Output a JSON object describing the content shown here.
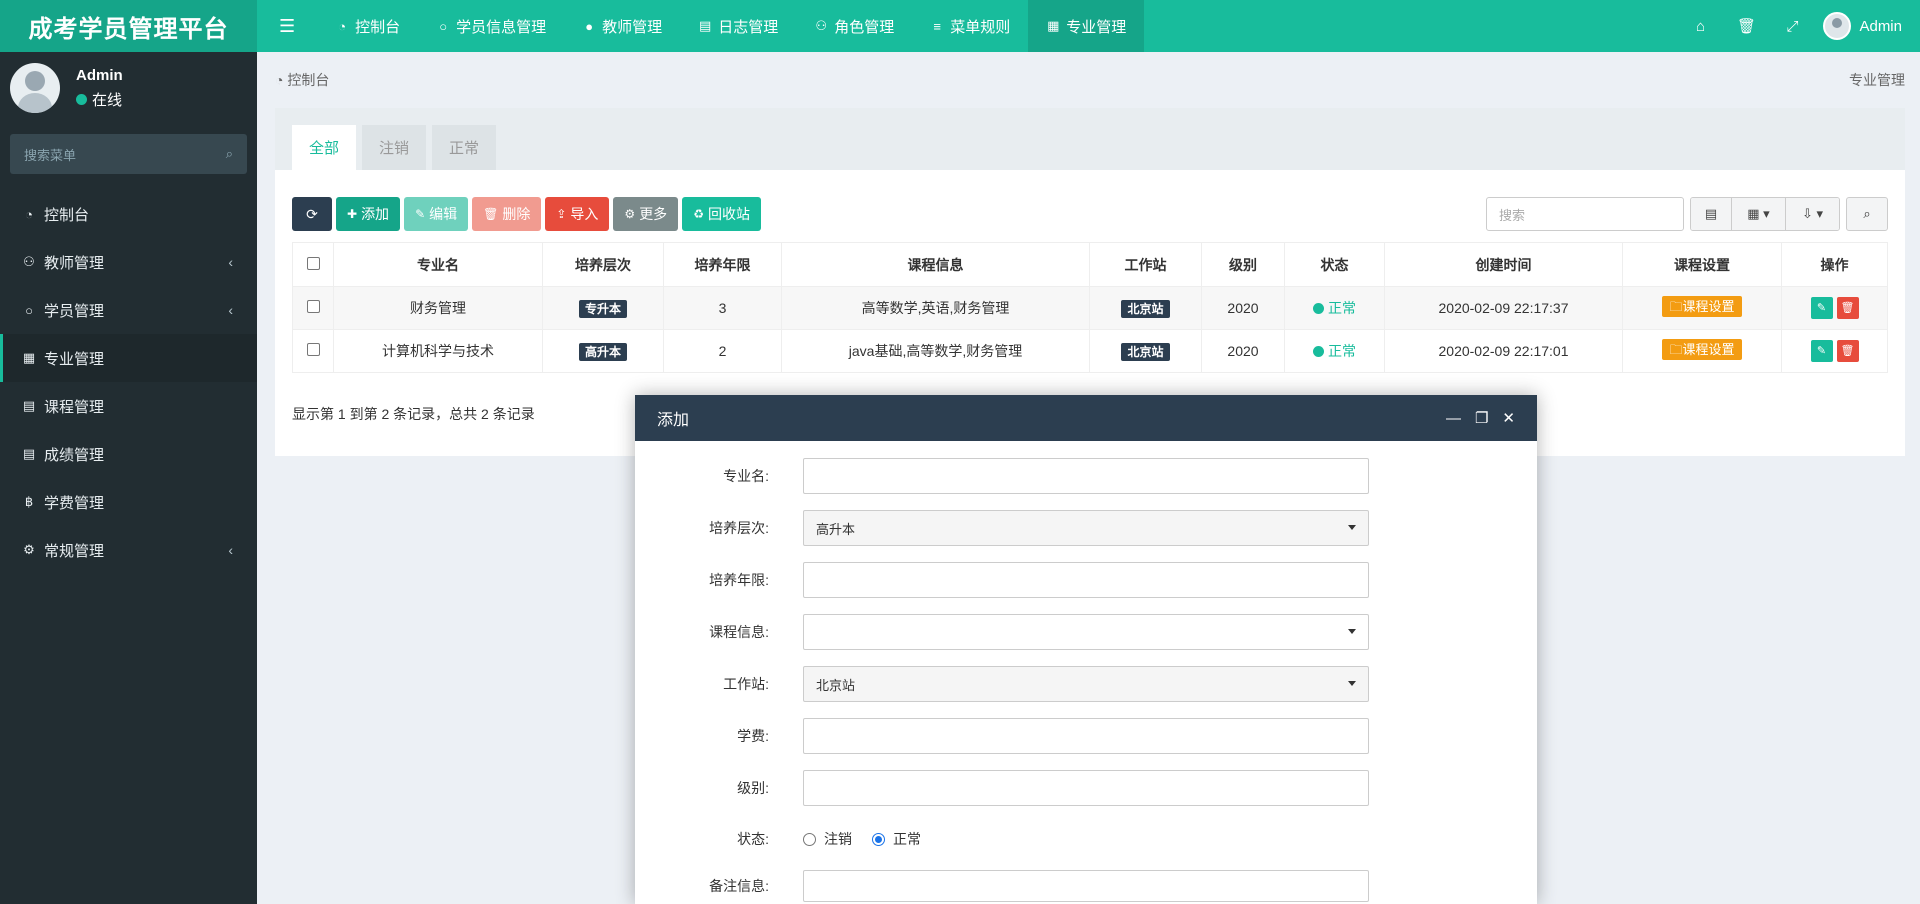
{
  "app": {
    "title": "成考学员管理平台"
  },
  "topnav": {
    "items": [
      {
        "label": "控制台",
        "icon": "dashboard-icon"
      },
      {
        "label": "学员信息管理",
        "icon": "circle-icon"
      },
      {
        "label": "教师管理",
        "icon": "user-icon"
      },
      {
        "label": "日志管理",
        "icon": "list-icon"
      },
      {
        "label": "角色管理",
        "icon": "group-icon"
      },
      {
        "label": "菜单规则",
        "icon": "bars-icon"
      },
      {
        "label": "专业管理",
        "icon": "table-icon",
        "active": true
      }
    ],
    "user": "Admin"
  },
  "sidebar": {
    "user": {
      "name": "Admin",
      "status": "在线"
    },
    "search_placeholder": "搜索菜单",
    "items": [
      {
        "label": "控制台"
      },
      {
        "label": "教师管理"
      },
      {
        "label": "学员管理"
      },
      {
        "label": "专业管理"
      },
      {
        "label": "课程管理"
      },
      {
        "label": "成绩管理"
      },
      {
        "label": "学费管理"
      },
      {
        "label": "常规管理"
      }
    ]
  },
  "breadcrumb": {
    "left": "控制台",
    "right": "专业管理"
  },
  "tabs": [
    "全部",
    "注销",
    "正常"
  ],
  "toolbar": {
    "add": "添加",
    "edit": "编辑",
    "delete": "删除",
    "import": "导入",
    "more": "更多",
    "recycle": "回收站",
    "search_placeholder": "搜索"
  },
  "table": {
    "headers": [
      "专业名",
      "培养层次",
      "培养年限",
      "课程信息",
      "工作站",
      "级别",
      "状态",
      "创建时间",
      "课程设置",
      "操作"
    ],
    "rows": [
      {
        "name": "财务管理",
        "level": "专升本",
        "years": "3",
        "courses": "高等数学,英语,财务管理",
        "station": "北京站",
        "grade": "2020",
        "status": "正常",
        "created": "2020-02-09 22:17:37",
        "setting": "课程设置"
      },
      {
        "name": "计算机科学与技术",
        "level": "高升本",
        "years": "2",
        "courses": "java基础,高等数学,财务管理",
        "station": "北京站",
        "grade": "2020",
        "status": "正常",
        "created": "2020-02-09 22:17:01",
        "setting": "课程设置"
      }
    ],
    "pageinfo": "显示第 1 到第 2 条记录，总共 2 条记录"
  },
  "modal": {
    "title": "添加",
    "fields": {
      "name_label": "专业名:",
      "level_label": "培养层次:",
      "level_value": "高升本",
      "years_label": "培养年限:",
      "courses_label": "课程信息:",
      "station_label": "工作站:",
      "station_value": "北京站",
      "fee_label": "学费:",
      "grade_label": "级别:",
      "status_label": "状态:",
      "status_opt1": "注销",
      "status_opt2": "正常",
      "remark_label": "备注信息:"
    }
  },
  "colors": {
    "primary": "#18bc9c",
    "dark": "#2c3e50",
    "sidebar": "#222d32",
    "danger": "#e74c3c",
    "warning": "#f39c12"
  }
}
